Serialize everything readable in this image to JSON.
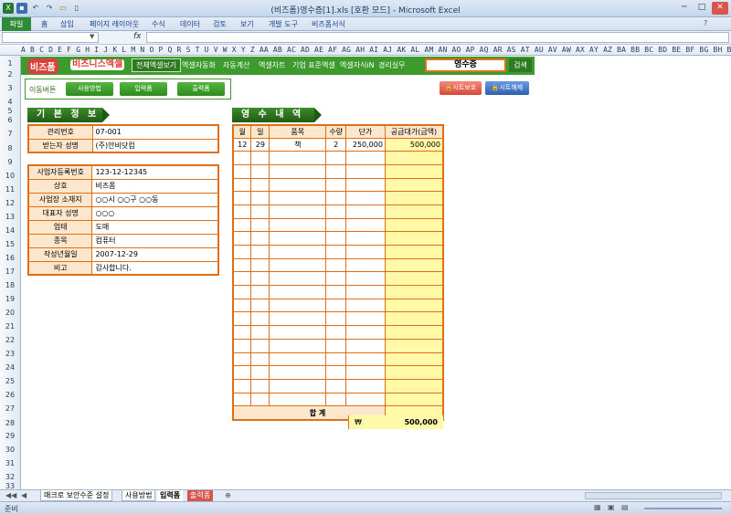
{
  "window": {
    "title": "(비즈폼)영수증[1].xls  [호환 모드] - Microsoft Excel",
    "minimize": "─",
    "maximize": "□",
    "close": "✕"
  },
  "ribbon": {
    "file_tab": "파일",
    "tabs": [
      "홈",
      "삽입",
      "페이지 레이아웃",
      "수식",
      "데이터",
      "검토",
      "보기",
      "개발 도구",
      "비즈폼서식"
    ]
  },
  "formula_bar": {
    "fx": "fx",
    "cell": "",
    "content": ""
  },
  "columns": "A B C D E F G H I J K L M N O P Q R S T U V W X Y Z AA AB AC AD AE AF AG AH AI AJ AK AL AM AN AO AP AQ AR AS AT AU AV AW AX AY AZ BA BB BC BD BE BF BG BH BI BJ BK BL BM BN BO BP BQ BR BS BT BU",
  "rows": [
    "1",
    "2",
    "3",
    "4",
    "5",
    "6",
    "7",
    "8",
    "9",
    "10",
    "11",
    "12",
    "13",
    "14",
    "15",
    "16",
    "17",
    "18",
    "19",
    "20",
    "21",
    "22",
    "23",
    "24",
    "25",
    "26",
    "27",
    "28",
    "29",
    "30",
    "31",
    "32",
    "33"
  ],
  "header": {
    "logo_a": "비즈폼",
    "logo_b": "비즈니스엑셀",
    "menu": [
      "전체엑셀보기",
      "엑셀자동화",
      "자동계산",
      "엑셀차트",
      "기업 표준엑셀",
      "엑셀자식iN",
      "경리실무"
    ],
    "doc_title": "영수증",
    "search": "검색"
  },
  "nav": {
    "label": "이동버튼",
    "buttons": [
      "사용방법",
      "입력폼",
      "출력폼"
    ],
    "protect": "시트보호",
    "unprotect": "시트해제"
  },
  "basic": {
    "title": "기 본 정 보",
    "rows": [
      {
        "k": "관리번호",
        "v": "07-001"
      },
      {
        "k": "받는자 성명",
        "v": "(주)안비닷컴"
      }
    ]
  },
  "supplier": {
    "rows": [
      {
        "k": "사업자등록번호",
        "v": "123-12-12345"
      },
      {
        "k": "상호",
        "v": "비즈폼"
      },
      {
        "k": "사업장 소재지",
        "v": "○○시 ○○구 ○○동"
      },
      {
        "k": "대표자 성명",
        "v": "○○○"
      },
      {
        "k": "업태",
        "v": "도매"
      },
      {
        "k": "종목",
        "v": "컴퓨터"
      },
      {
        "k": "작성년월일",
        "v": "2007-12-29"
      },
      {
        "k": "비고",
        "v": "감사합니다."
      }
    ]
  },
  "receipt": {
    "title": "영 수 내 역",
    "headers": [
      "월",
      "일",
      "품목",
      "수량",
      "단가",
      "공급대가(금액)"
    ],
    "items": [
      {
        "month": "12",
        "day": "29",
        "item": "책",
        "qty": "2",
        "price": "250,000",
        "amount": "500,000"
      }
    ],
    "total_label": "합    계",
    "currency": "₩",
    "total": "500,000"
  },
  "sheet_tabs": [
    "매크로 보안수준 설정",
    "사용방법",
    "입력폼",
    "출력폼"
  ],
  "status": {
    "ready": "준비"
  }
}
